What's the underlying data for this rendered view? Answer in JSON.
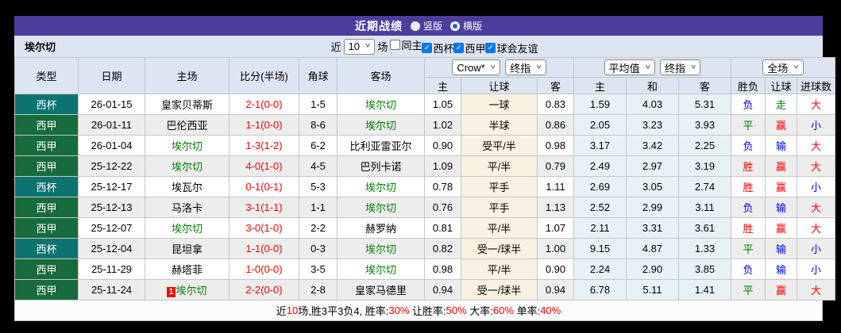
{
  "title_bar": {
    "title": "近期战绩",
    "radios": [
      {
        "label": "竖版",
        "checked": false
      },
      {
        "label": "横版",
        "checked": true
      }
    ]
  },
  "filter_bar": {
    "team": "埃尔切",
    "near_label": "近",
    "matches_select": "10",
    "field_label": "场",
    "checkboxes": [
      {
        "label": "同主",
        "checked": false
      },
      {
        "label": "西杯",
        "checked": true
      },
      {
        "label": "西甲",
        "checked": true
      },
      {
        "label": "球会友谊",
        "checked": true
      }
    ]
  },
  "table": {
    "left_headers": [
      "类型",
      "日期",
      "主场",
      "比分(半场)",
      "角球",
      "客场"
    ],
    "group1": {
      "select1": "Crow*",
      "select2": "终指",
      "cols": [
        "主",
        "让球",
        "客"
      ]
    },
    "group2": {
      "select1": "平均值",
      "select2": "终指",
      "cols": [
        "主",
        "和",
        "客"
      ]
    },
    "group3": {
      "select1": "全场",
      "cols": [
        "胜负",
        "让球",
        "进球数"
      ]
    },
    "rows": [
      {
        "type": "西杯",
        "date": "26-01-15",
        "home": "皇家贝蒂斯",
        "home_green": false,
        "home_badge": "",
        "score": "2-1(0-0)",
        "corner": "1-5",
        "away": "埃尔切",
        "away_green": true,
        "odds_home": "1.05",
        "handicap": "一球",
        "odds_away": "0.83",
        "avg_home": "1.59",
        "avg_draw": "4.03",
        "avg_away": "5.31",
        "result": "负",
        "handicap_result": "走",
        "goals": "大"
      },
      {
        "type": "西甲",
        "date": "26-01-11",
        "home": "巴伦西亚",
        "home_green": false,
        "home_badge": "",
        "score": "1-1(0-0)",
        "corner": "8-6",
        "away": "埃尔切",
        "away_green": true,
        "odds_home": "1.02",
        "handicap": "半球",
        "odds_away": "0.86",
        "avg_home": "2.05",
        "avg_draw": "3.23",
        "avg_away": "3.93",
        "result": "平",
        "handicap_result": "赢",
        "goals": "小"
      },
      {
        "type": "西甲",
        "date": "26-01-04",
        "home": "埃尔切",
        "home_green": true,
        "home_badge": "",
        "score": "1-3(1-2)",
        "corner": "6-2",
        "away": "比利亚雷亚尔",
        "away_green": false,
        "odds_home": "0.90",
        "handicap": "受平/半",
        "odds_away": "0.98",
        "avg_home": "3.17",
        "avg_draw": "3.42",
        "avg_away": "2.25",
        "result": "负",
        "handicap_result": "输",
        "goals": "大"
      },
      {
        "type": "西甲",
        "date": "25-12-22",
        "home": "埃尔切",
        "home_green": true,
        "home_badge": "",
        "score": "4-0(1-0)",
        "corner": "4-5",
        "away": "巴列卡诺",
        "away_green": false,
        "odds_home": "1.09",
        "handicap": "平/半",
        "odds_away": "0.79",
        "avg_home": "2.49",
        "avg_draw": "2.97",
        "avg_away": "3.19",
        "result": "胜",
        "handicap_result": "赢",
        "goals": "大"
      },
      {
        "type": "西杯",
        "date": "25-12-17",
        "home": "埃瓦尔",
        "home_green": false,
        "home_badge": "",
        "score": "0-1(0-1)",
        "corner": "5-3",
        "away": "埃尔切",
        "away_green": true,
        "odds_home": "0.78",
        "handicap": "平手",
        "odds_away": "1.11",
        "avg_home": "2.69",
        "avg_draw": "3.05",
        "avg_away": "2.74",
        "result": "胜",
        "handicap_result": "赢",
        "goals": "小"
      },
      {
        "type": "西甲",
        "date": "25-12-13",
        "home": "马洛卡",
        "home_green": false,
        "home_badge": "",
        "score": "3-1(1-1)",
        "corner": "1-1",
        "away": "埃尔切",
        "away_green": true,
        "odds_home": "0.76",
        "handicap": "平手",
        "odds_away": "1.13",
        "avg_home": "2.52",
        "avg_draw": "2.99",
        "avg_away": "3.11",
        "result": "负",
        "handicap_result": "输",
        "goals": "大"
      },
      {
        "type": "西甲",
        "date": "25-12-07",
        "home": "埃尔切",
        "home_green": true,
        "home_badge": "",
        "score": "3-0(1-0)",
        "corner": "2-2",
        "away": "赫罗纳",
        "away_green": false,
        "odds_home": "0.81",
        "handicap": "平/半",
        "odds_away": "1.07",
        "avg_home": "2.11",
        "avg_draw": "3.31",
        "avg_away": "3.61",
        "result": "胜",
        "handicap_result": "赢",
        "goals": "大"
      },
      {
        "type": "西杯",
        "date": "25-12-04",
        "home": "昆坦拿",
        "home_green": false,
        "home_badge": "",
        "score": "1-1(0-0)",
        "corner": "0-3",
        "away": "埃尔切",
        "away_green": true,
        "odds_home": "0.82",
        "handicap": "受一/球半",
        "odds_away": "1.00",
        "avg_home": "9.15",
        "avg_draw": "4.87",
        "avg_away": "1.33",
        "result": "平",
        "handicap_result": "输",
        "goals": "小"
      },
      {
        "type": "西甲",
        "date": "25-11-29",
        "home": "赫塔菲",
        "home_green": false,
        "home_badge": "",
        "score": "1-0(0-0)",
        "corner": "3-5",
        "away": "埃尔切",
        "away_green": true,
        "odds_home": "0.98",
        "handicap": "平/半",
        "odds_away": "0.90",
        "avg_home": "2.24",
        "avg_draw": "2.90",
        "avg_away": "3.85",
        "result": "负",
        "handicap_result": "输",
        "goals": "小"
      },
      {
        "type": "西甲",
        "date": "25-11-24",
        "home": "埃尔切",
        "home_green": true,
        "home_badge": "1",
        "score": "2-2(0-0)",
        "corner": "2-8",
        "away": "皇家马德里",
        "away_green": false,
        "odds_home": "0.94",
        "handicap": "受一/球半",
        "odds_away": "0.94",
        "avg_home": "6.78",
        "avg_draw": "5.11",
        "avg_away": "1.41",
        "result": "平",
        "handicap_result": "赢",
        "goals": "大"
      }
    ]
  },
  "summary": {
    "segments": [
      {
        "text": "近",
        "red": false
      },
      {
        "text": "10",
        "red": true
      },
      {
        "text": "场,胜3平3负4, 胜率:",
        "red": false
      },
      {
        "text": "30%",
        "red": true
      },
      {
        "text": " 让胜率:",
        "red": false
      },
      {
        "text": "50%",
        "red": true
      },
      {
        "text": " 大率:",
        "red": false
      },
      {
        "text": "60%",
        "red": true
      },
      {
        "text": " 单率:",
        "red": false
      },
      {
        "text": "40%",
        "red": true
      }
    ]
  },
  "colors": {
    "type_bg": {
      "西杯": "#0B7370",
      "西甲": "#176B3C"
    },
    "result_text": {
      "胜": "#FF0000",
      "平": "#008000",
      "负": "#0000FF",
      "赢": "#FF0000",
      "输": "#0000FF",
      "走": "#008000",
      "大": "#FF0000",
      "小": "#0000FF"
    },
    "accent_purple": "#4D3D9D",
    "header_bg": "#DCE5F1",
    "handicap_col_bg": "#FAF1E3",
    "avg_col_bg": "#E6F2F6"
  }
}
